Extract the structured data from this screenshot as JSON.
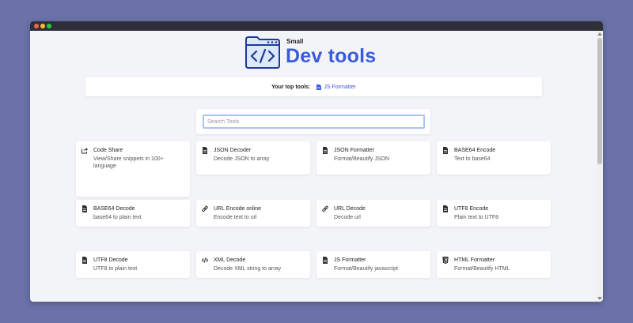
{
  "app": {
    "small_label": "Small",
    "title": "Dev tools"
  },
  "top_tools": {
    "label": "Your top tools:",
    "link": "JS Formatter"
  },
  "search": {
    "placeholder": "Search Tools"
  },
  "tools": [
    {
      "title": "Code Share",
      "desc": "View/Share snippets in 100+ language",
      "icon": "share-icon"
    },
    {
      "title": "JSON Decoder",
      "desc": "Decode JSON to array",
      "icon": "file-icon"
    },
    {
      "title": "JSON Formatter",
      "desc": "Format/Beautify JSON",
      "icon": "file-icon"
    },
    {
      "title": "BASE64 Encode",
      "desc": "Text to base64",
      "icon": "file-icon"
    },
    {
      "title": "BASE64 Decode",
      "desc": "base64 to plain text",
      "icon": "file-icon"
    },
    {
      "title": "URL Encode online",
      "desc": "Encode text to url",
      "icon": "link-icon"
    },
    {
      "title": "URL Decode",
      "desc": "Decode url",
      "icon": "link-icon"
    },
    {
      "title": "UTF8 Encode",
      "desc": "Plain text to UTF8",
      "icon": "file-icon"
    },
    {
      "title": "UTF8 Decode",
      "desc": "UTF8 to plain text",
      "icon": "file-icon"
    },
    {
      "title": "XML Decode",
      "desc": "Decode XML string to array",
      "icon": "code-icon"
    },
    {
      "title": "JS Formatter",
      "desc": "Format/Beautify javascript",
      "icon": "file-icon"
    },
    {
      "title": "HTML Formatter",
      "desc": "Format/Beautify HTML",
      "icon": "html5-icon"
    }
  ],
  "colors": {
    "accent": "#3b5bdb",
    "background": "#6a72a9",
    "page": "#f3f4f7"
  }
}
